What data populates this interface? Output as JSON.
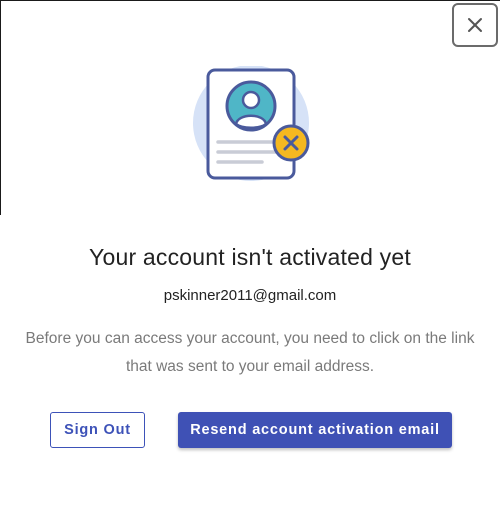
{
  "dialog": {
    "title": "Your account isn't activated yet",
    "email": "pskinner2011@gmail.com",
    "message": "Before you can access your account, you need to click on the link that was sent to your email address.",
    "close_icon": "close-icon",
    "illustration_icon": "inactive-account-document-icon"
  },
  "buttons": {
    "sign_out": "Sign Out",
    "resend": "Resend account activation email"
  },
  "colors": {
    "primary": "#3f51b5",
    "badge_yellow": "#f5b820",
    "avatar_teal": "#4fb6c7",
    "illustration_circle": "#d6e2f7",
    "illustration_stroke": "#4a5a9c",
    "message_gray": "#7a7a7a"
  }
}
